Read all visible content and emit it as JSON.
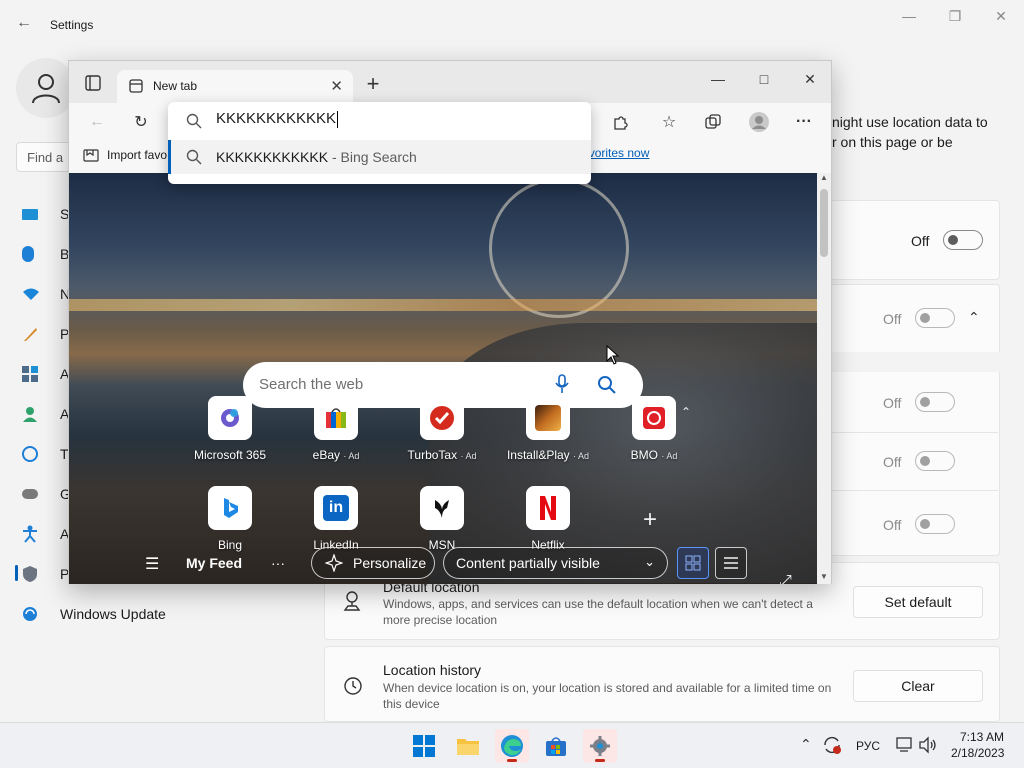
{
  "settings": {
    "title": "Settings",
    "search_placeholder": "Find a",
    "nav": [
      {
        "label": "S",
        "icon": "system-icon"
      },
      {
        "label": "B",
        "icon": "bluetooth-icon"
      },
      {
        "label": "N",
        "icon": "network-icon"
      },
      {
        "label": "P",
        "icon": "personalization-icon"
      },
      {
        "label": "A",
        "icon": "apps-icon"
      },
      {
        "label": "A",
        "icon": "accounts-icon"
      },
      {
        "label": "T",
        "icon": "time-language-icon"
      },
      {
        "label": "G",
        "icon": "gaming-icon"
      },
      {
        "label": "A",
        "icon": "accessibility-icon"
      },
      {
        "label": "P",
        "icon": "privacy-security-icon"
      },
      {
        "label": "Windows Update",
        "icon": "windows-update-icon"
      }
    ],
    "partial_text": "night use location data to\nr on this page or be",
    "toggles": [
      {
        "label": "Off"
      },
      {
        "label": "Off"
      },
      {
        "label": "Off"
      },
      {
        "label": "Off"
      },
      {
        "label": "Off"
      }
    ],
    "default_location": {
      "title": "Default location",
      "description": "Windows, apps, and services can use the default location when we can't detect a more precise location",
      "button": "Set default"
    },
    "location_history": {
      "title": "Location history",
      "description": "When device location is on, your location is stored and available for a limited time on this device",
      "button": "Clear"
    }
  },
  "edge": {
    "tab_title": "New tab",
    "favorites_import": "Import favo",
    "favorites_link": "ge favorites now",
    "omnibox": {
      "value": "KKKKKKKKKKKK",
      "suggestion_main": "KKKKKKKKKKKK",
      "suggestion_sub": " - Bing Search"
    },
    "ntp": {
      "search_placeholder": "Search the web",
      "tiles_row1": [
        {
          "label": "Microsoft 365",
          "ad": ""
        },
        {
          "label": "eBay",
          "ad": "· Ad"
        },
        {
          "label": "TurboTax",
          "ad": "· Ad"
        },
        {
          "label": "Install&Play",
          "ad": "· Ad"
        },
        {
          "label": "BMO",
          "ad": "· Ad"
        }
      ],
      "tiles_row2": [
        {
          "label": "Bing",
          "ad": ""
        },
        {
          "label": "LinkedIn",
          "ad": ""
        },
        {
          "label": "MSN",
          "ad": ""
        },
        {
          "label": "Netflix",
          "ad": ""
        }
      ],
      "feed": {
        "my_feed": "My Feed",
        "more": "···",
        "personalize": "Personalize",
        "content": "Content partially visible"
      }
    }
  },
  "taskbar": {
    "language": "РУС",
    "time": "7:13 AM",
    "date": "2/18/2023"
  }
}
